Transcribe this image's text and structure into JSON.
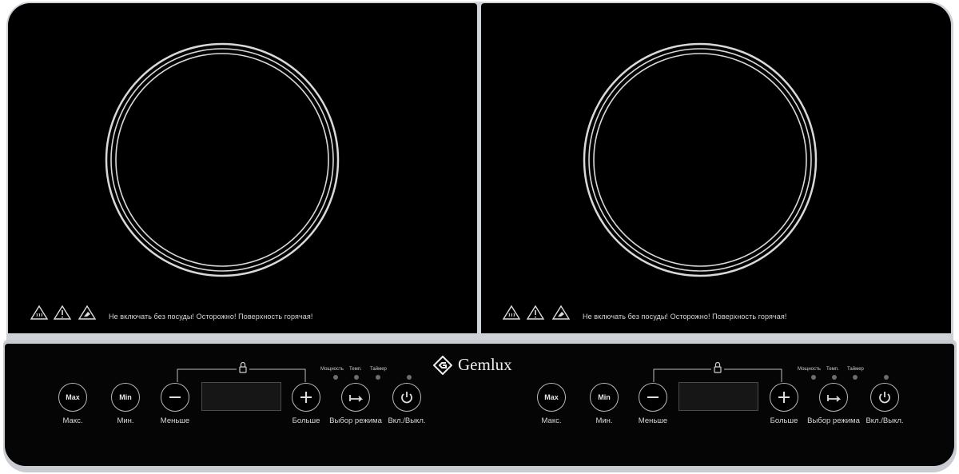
{
  "brand": {
    "name": "Gemlux"
  },
  "zones": [
    {
      "warning": "Не включать без посуды! Осторожно! Поверхность горячая!",
      "buttons": {
        "max": {
          "face": "Max",
          "label": "Макс."
        },
        "min": {
          "face": "Min",
          "label": "Мин."
        },
        "minus": {
          "label": "Меньше"
        },
        "plus": {
          "label": "Больше"
        },
        "mode": {
          "label": "Выбор режима"
        },
        "power": {
          "label": "Вкл./Выкл."
        }
      },
      "indicators": [
        "Мощность",
        "Темп.",
        "Таймер"
      ]
    },
    {
      "warning": "Не включать без посуды! Осторожно! Поверхность горячая!",
      "buttons": {
        "max": {
          "face": "Max",
          "label": "Макс."
        },
        "min": {
          "face": "Min",
          "label": "Мин."
        },
        "minus": {
          "label": "Меньше"
        },
        "plus": {
          "label": "Больше"
        },
        "mode": {
          "label": "Выбор режима"
        },
        "power": {
          "label": "Вкл./Выкл."
        }
      },
      "indicators": [
        "Мощность",
        "Темп.",
        "Таймер"
      ]
    }
  ],
  "icons": [
    "hot-surface-icon",
    "warning-icon",
    "hand-hazard-icon",
    "lock-icon",
    "minus-icon",
    "plus-icon",
    "mode-arrow-icon",
    "power-icon",
    "gemlux-logo-icon"
  ],
  "colors": {
    "glass": "#000000",
    "frame": "#cfd2d7",
    "ring": "#d9d9d9",
    "text": "#d8d8d8"
  }
}
